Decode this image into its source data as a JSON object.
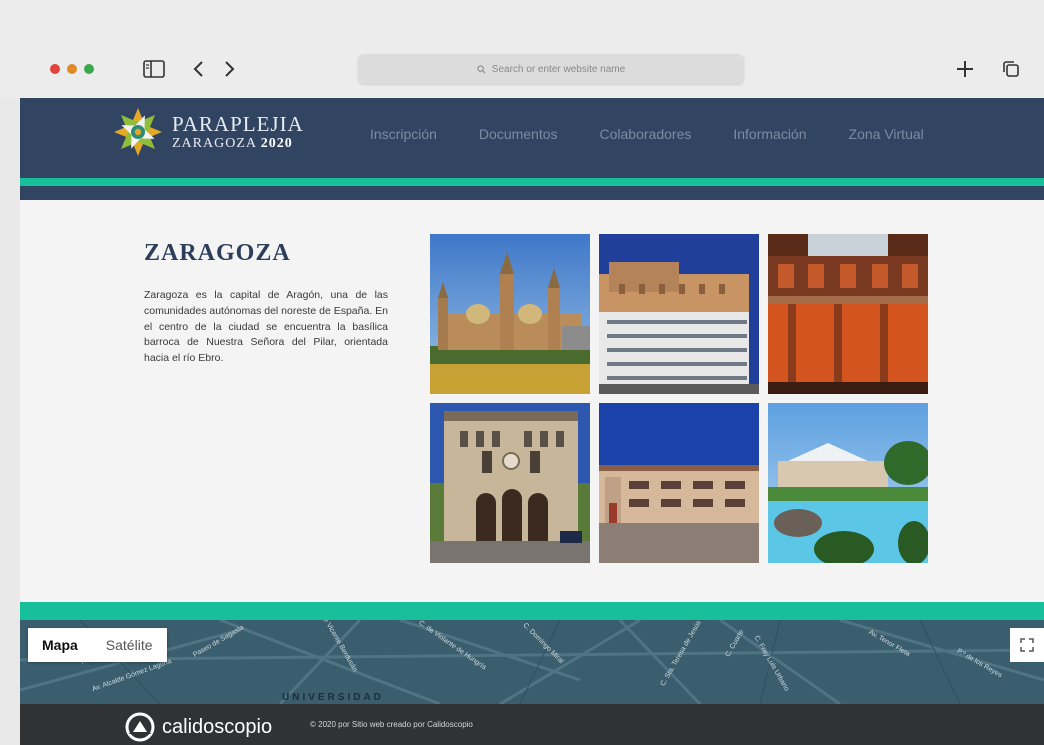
{
  "browser": {
    "url_placeholder": "Search or enter website name"
  },
  "logo": {
    "line1": "PARAPLEJIA",
    "line2_city": "ZARAGOZA",
    "line2_year": "2020"
  },
  "nav": {
    "items": [
      "Inscripción",
      "Documentos",
      "Colaboradores",
      "Información",
      "Zona Virtual"
    ]
  },
  "content": {
    "title": "ZARAGOZA",
    "text": "Zaragoza es la capital de Aragón, una de las comunidades autónomas del noreste de España. En el centro de la ciudad se encuentra la basílica barroca de Nuestra Señora del Pilar, orientada hacia el río Ebro."
  },
  "map": {
    "tab_map": "Mapa",
    "tab_satellite": "Satélite",
    "labels": [
      "Av. Alcalde Gómez Laguna",
      "Av. Luis Bermúdez",
      "C. de Vicente Berdusán",
      "C. Domingo Miral",
      "C. de Violante de Hungría",
      "C. Sta. Teresa de Jesús",
      "C. Cuarte",
      "C. Fray Luis Urbano",
      "Av. Tenor Fleta",
      "P.º de los Reyes",
      "Paseo de Sagasta"
    ],
    "big_label": "UNIVERSIDAD"
  },
  "footer": {
    "brand": "calidoscopio",
    "copyright": "© 2020 por Sitio web creado por Calidoscopio"
  },
  "colors": {
    "header_navy": "#314562",
    "accent_teal": "#17c09a",
    "footer_dark": "#303233"
  }
}
